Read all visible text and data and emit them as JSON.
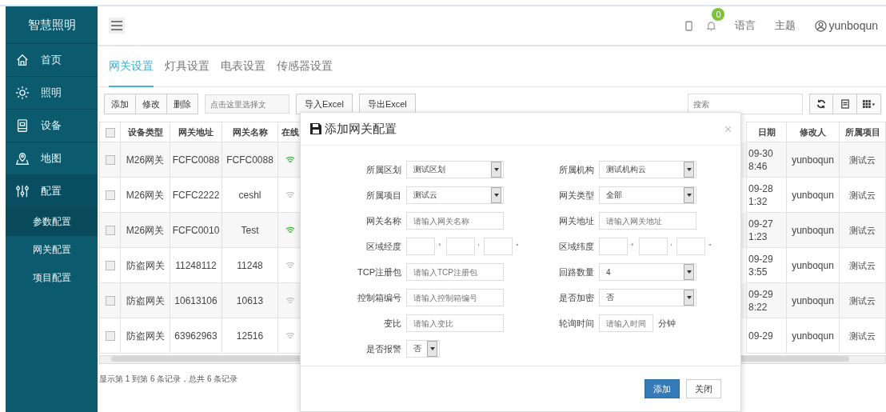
{
  "sidebar": {
    "logo": "智慧照明",
    "items": [
      {
        "label": "首页"
      },
      {
        "label": "照明"
      },
      {
        "label": "设备"
      },
      {
        "label": "地图"
      },
      {
        "label": "配置",
        "expanded": true,
        "children": [
          {
            "label": "参数配置",
            "selected": true
          },
          {
            "label": "网关配置",
            "selected": false
          },
          {
            "label": "项目配置",
            "selected": false
          }
        ]
      }
    ]
  },
  "header": {
    "notification_count": "0",
    "links": [
      "语言",
      "主题"
    ],
    "user": "yunboqun"
  },
  "tabs": [
    {
      "label": "网关设置",
      "selected": true
    },
    {
      "label": "灯具设置",
      "selected": false
    },
    {
      "label": "电表设置",
      "selected": false
    },
    {
      "label": "传感器设置",
      "selected": false
    }
  ],
  "toolbar": {
    "group": [
      "添加",
      "修改",
      "删除"
    ],
    "file_placeholder": "点击这里选择文",
    "buttons": [
      "导入Excel",
      "导出Excel"
    ],
    "search_placeholder": "搜索"
  },
  "table": {
    "all_checked": false,
    "columns": [
      "设备类型",
      "网关地址",
      "网关名称",
      "在线",
      "日期",
      "修改人",
      "所属项目"
    ],
    "rows": [
      {
        "checked": false,
        "type": "M26网关",
        "address": "FCFC0088",
        "name": "FCFC0088",
        "online": true,
        "date": "09-30 8:46",
        "modifier": "yunboqun",
        "project": "测试云"
      },
      {
        "checked": false,
        "type": "M26网关",
        "address": "FCFC2222",
        "name": "ceshl",
        "online": false,
        "date": "09-28 1:32",
        "modifier": "yunboqun",
        "project": "测试云"
      },
      {
        "checked": false,
        "type": "M26网关",
        "address": "FCFC0010",
        "name": "Test",
        "online": true,
        "date": "09-27 1:23",
        "modifier": "yunboqun",
        "project": "测试云"
      },
      {
        "checked": false,
        "type": "防盗网关",
        "address": "11248112",
        "name": "11248",
        "online": false,
        "date": "09-29 3:55",
        "modifier": "yunboqun",
        "project": "测试云"
      },
      {
        "checked": false,
        "type": "防盗网关",
        "address": "10613106",
        "name": "10613",
        "online": false,
        "date": "09-29 8:22",
        "modifier": "yunboqun",
        "project": "测试云"
      },
      {
        "checked": false,
        "type": "防盗网关",
        "address": "63962963",
        "name": "12516",
        "online": false,
        "date": "09-29",
        "modifier": "yunboqun",
        "project": "测试云"
      }
    ],
    "footer": "显示第 1 到第 6 条记录，总共 6 条记录"
  },
  "modal": {
    "title": "添加网关配置",
    "columns": [
      [
        {
          "kind": "select",
          "label": "所属区划",
          "value": "测试区划"
        },
        {
          "kind": "select",
          "label": "所属项目",
          "value": "测试云"
        },
        {
          "kind": "input",
          "label": "网关名称",
          "placeholder": "请输入网关名称"
        },
        {
          "kind": "coords",
          "label": "区域经度",
          "marks": [
            "°",
            "′",
            "″"
          ]
        },
        {
          "kind": "input",
          "label": "TCP注册包",
          "placeholder": "请输入TCP注册包"
        },
        {
          "kind": "input",
          "label": "控制箱编号",
          "placeholder": "请输入控制箱编号"
        },
        {
          "kind": "input",
          "label": "变比",
          "placeholder": "请输入变比"
        },
        {
          "kind": "small-select",
          "label": "是否报警",
          "value": "否"
        }
      ],
      [
        {
          "kind": "select",
          "label": "所属机构",
          "value": "测试机构云"
        },
        {
          "kind": "select",
          "label": "网关类型",
          "value": "全部"
        },
        {
          "kind": "input",
          "label": "网关地址",
          "placeholder": "请输入网关地址"
        },
        {
          "kind": "coords",
          "label": "区域纬度",
          "marks": [
            "°",
            "′",
            "″"
          ]
        },
        {
          "kind": "select",
          "label": "回路数量",
          "value": "4"
        },
        {
          "kind": "select",
          "label": "是否加密",
          "value": "否"
        },
        {
          "kind": "input",
          "label": "轮询时间",
          "placeholder": "请输入时间",
          "unit": "分钟"
        }
      ]
    ],
    "buttons": [
      {
        "label": "添加",
        "primary": true
      },
      {
        "label": "关闭",
        "primary": false
      }
    ]
  }
}
